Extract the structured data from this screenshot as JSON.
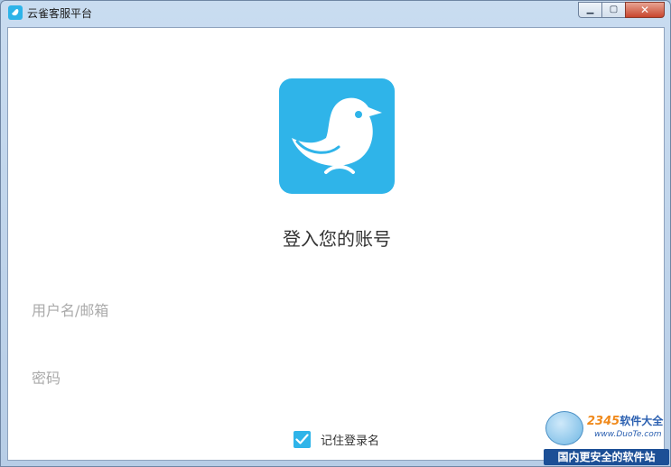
{
  "window": {
    "title": "云雀客服平台",
    "caption": {
      "minimize": "▁",
      "maximize": "▢",
      "close": "✕"
    }
  },
  "icons": {
    "app": "bird-icon",
    "logo": "bird-logo-icon",
    "check": "check-icon"
  },
  "colors": {
    "brand": "#2fb4e9",
    "placeholder": "#aaaaaa",
    "text": "#333333"
  },
  "login": {
    "heading": "登入您的账号",
    "username": {
      "placeholder": "用户名/邮箱",
      "value": ""
    },
    "password": {
      "placeholder": "密码",
      "value": ""
    },
    "remember": {
      "label": "记住登录名",
      "checked": true
    }
  },
  "watermark": {
    "brand_number": "2345",
    "brand_text": "软件大全",
    "url": "www.DuoTe.com",
    "slogan": "国内更安全的软件站"
  }
}
